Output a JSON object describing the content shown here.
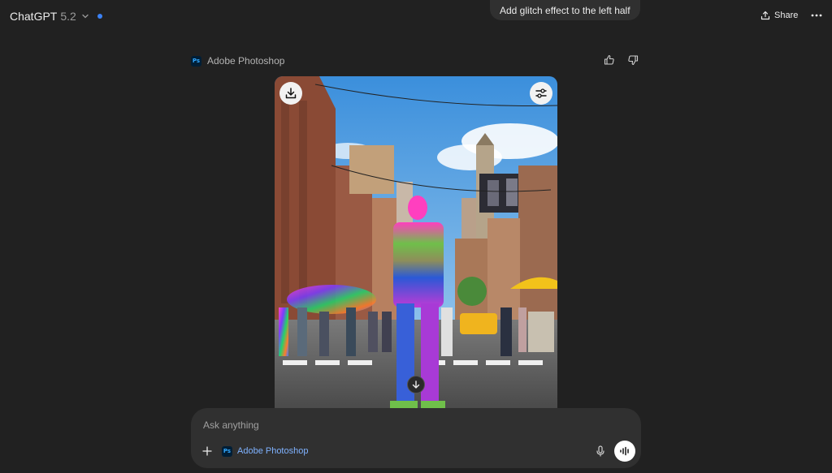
{
  "header": {
    "model_name": "ChatGPT",
    "model_version": "5.2",
    "share_label": "Share"
  },
  "conversation": {
    "user_message": "Add glitch effect to the left half",
    "tool_name": "Adobe Photoshop",
    "tool_logo_text": "Ps"
  },
  "composer": {
    "placeholder": "Ask anything",
    "tool_chip_label": "Adobe Photoshop",
    "tool_chip_logo": "Ps"
  },
  "colors": {
    "background": "#212121",
    "surface": "#303030",
    "accent_blue": "#3b82f6",
    "photoshop_blue": "#31a8ff"
  },
  "icons": [
    "chevron-down-icon",
    "share-icon",
    "more-icon",
    "thumbs-up-icon",
    "thumbs-down-icon",
    "download-icon",
    "sliders-icon",
    "arrow-down-icon",
    "plus-icon",
    "microphone-icon",
    "voice-waveform-icon"
  ]
}
